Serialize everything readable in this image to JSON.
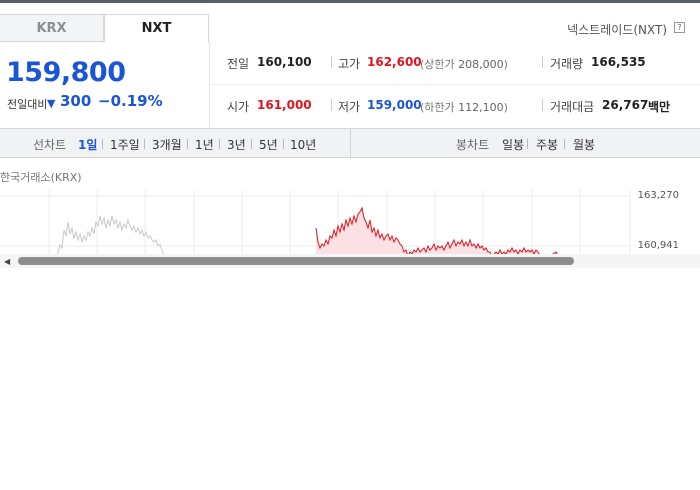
{
  "tabs": [
    {
      "label": "KRX",
      "active": false
    },
    {
      "label": "NXT",
      "active": true
    }
  ],
  "source": "넥스트레이드(NXT)",
  "help_icon": "?",
  "price": {
    "current": "159,800",
    "change_label": "전일대비",
    "change_arrow": "▼",
    "change_value": "300",
    "change_percent": "−0.19%"
  },
  "stats": {
    "prev_close": {
      "label": "전일",
      "value": "160,100"
    },
    "high": {
      "label": "고가",
      "value": "162,600",
      "limit_label": "상한가",
      "limit_value": "208,000"
    },
    "volume": {
      "label": "거래량",
      "value": "166,535"
    },
    "open": {
      "label": "시가",
      "value": "161,000"
    },
    "low": {
      "label": "저가",
      "value": "159,000",
      "limit_label": "하한가",
      "limit_value": "112,100"
    },
    "amount": {
      "label": "거래대금",
      "value": "26,767",
      "unit": "백만"
    }
  },
  "toolbar": {
    "line_chart_label": "선차트",
    "periods": [
      "1일",
      "1주일",
      "3개월",
      "1년",
      "3년",
      "5년",
      "10년"
    ],
    "active_period": "1일",
    "candle_chart_label": "봉차트",
    "candles": [
      "일봉",
      "주봉",
      "월봉"
    ]
  },
  "chart": {
    "market_label": "한국거래소(KRX)",
    "y_labels": [
      "163,270",
      "160,941"
    ]
  },
  "colors": {
    "up": "#e0141e",
    "down": "#1a55d6",
    "accent": "#1a55d6"
  }
}
